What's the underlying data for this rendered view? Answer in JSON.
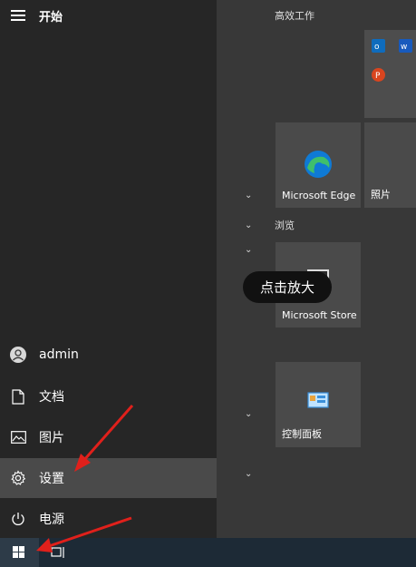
{
  "start_menu": {
    "title": "开始"
  },
  "nav": {
    "user": "admin",
    "documents": "文档",
    "pictures": "图片",
    "settings": "设置",
    "power": "电源"
  },
  "groups": {
    "productivity": "高效工作",
    "browse": "浏览"
  },
  "tiles": {
    "edge": "Microsoft Edge",
    "photos": "照片",
    "store": "Microsoft Store",
    "control_panel": "控制面板"
  },
  "overlay": {
    "zoom_hint": "点击放大"
  },
  "colors": {
    "accent_red": "#e0201b",
    "edge_blue": "#0f7ad5",
    "edge_green": "#3fbf6b"
  },
  "icons": {
    "outlook": "outlook-icon",
    "word": "word-icon",
    "powerpoint": "powerpoint-icon",
    "edge": "edge-icon",
    "store": "store-icon",
    "control_panel": "control-panel-icon",
    "windows": "windows-logo-icon",
    "task_view": "task-view-icon"
  }
}
